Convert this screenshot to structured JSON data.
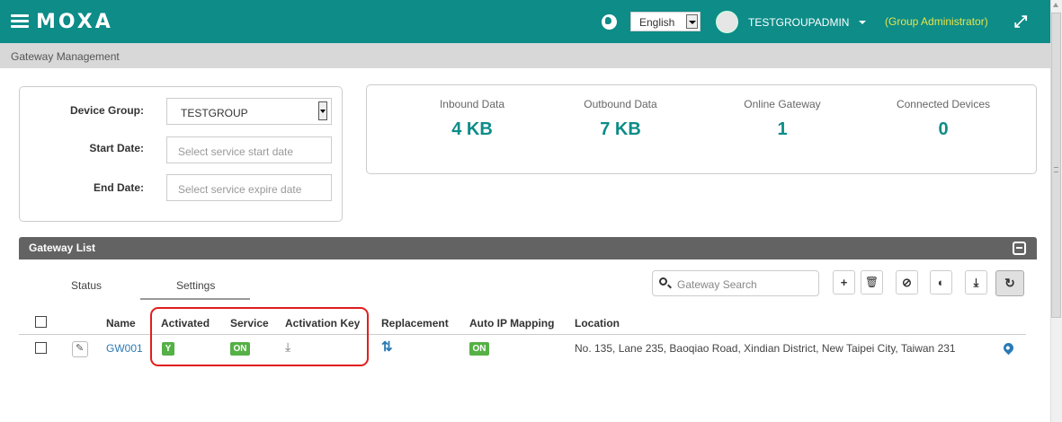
{
  "header": {
    "logo": "MOXA",
    "language": "English",
    "username": "TESTGROUPADMIN",
    "role": "(Group Administrator)"
  },
  "breadcrumb": "Gateway Management",
  "filters": {
    "device_group_label": "Device Group:",
    "device_group_value": "TESTGROUP",
    "start_date_label": "Start Date:",
    "start_date_placeholder": "Select service start date",
    "end_date_label": "End Date:",
    "end_date_placeholder": "Select service expire date"
  },
  "stats": [
    {
      "label": "Inbound Data",
      "value": "4 KB"
    },
    {
      "label": "Outbound Data",
      "value": "7 KB"
    },
    {
      "label": "Online Gateway",
      "value": "1"
    },
    {
      "label": "Connected Devices",
      "value": "0"
    }
  ],
  "gateway_list": {
    "title": "Gateway List",
    "tabs": [
      "Status",
      "Settings"
    ],
    "active_tab": "Settings",
    "search_placeholder": "Gateway Search",
    "columns": [
      "Name",
      "Activated",
      "Service",
      "Activation Key",
      "Replacement",
      "Auto IP Mapping",
      "Location"
    ],
    "rows": [
      {
        "name": "GW001",
        "activated": "Y",
        "service": "ON",
        "auto_ip_mapping": "ON",
        "location": "No. 135, Lane 235, Baoqiao Road, Xindian District, New Taipei City, Taiwan 231"
      }
    ]
  },
  "colors": {
    "brand": "#0d8c88",
    "role_text": "#e8e34a",
    "badge_green": "#55b046",
    "link_blue": "#2a7ab6",
    "highlight_red": "#e01e1e"
  },
  "icons": [
    "hamburger-menu-icon",
    "globe-icon",
    "chevron-down-icon",
    "expand-icon",
    "collapse-icon",
    "search-icon",
    "plus-icon",
    "trash-icon",
    "disable-icon",
    "toggle-icon",
    "download-icon",
    "refresh-icon",
    "edit-icon",
    "swap-icon",
    "map-pin-icon"
  ]
}
